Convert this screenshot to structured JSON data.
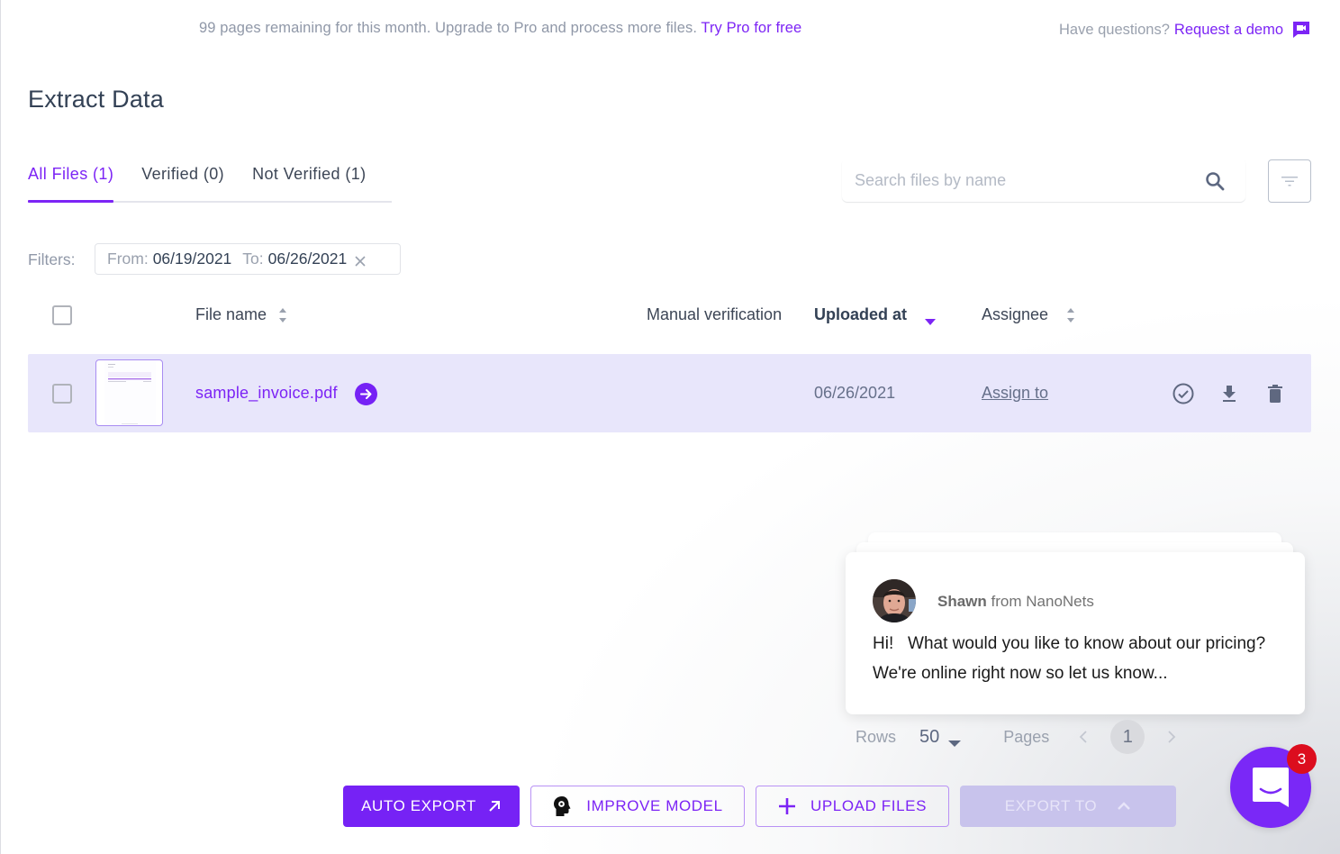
{
  "banner": {
    "quota_text": "99 pages remaining for this month. Upgrade to Pro and process more files.",
    "try_pro_link": "Try Pro for free",
    "help_text": "Have questions?",
    "demo_link": "Request a demo",
    "demo_icon": "video-chat-icon"
  },
  "page": {
    "title": "Extract Data"
  },
  "tabs": [
    {
      "label": "All Files (1)",
      "active": true
    },
    {
      "label": "Verified (0)",
      "active": false
    },
    {
      "label": "Not Verified (1)",
      "active": false
    }
  ],
  "search": {
    "placeholder": "Search files by name",
    "value": "",
    "icon": "search-icon"
  },
  "filter_button": {
    "icon": "filter-icon"
  },
  "filters": {
    "label": "Filters:",
    "from_label": "From:",
    "from_value": "06/19/2021",
    "to_label": "To:",
    "to_value": "06/26/2021"
  },
  "table": {
    "columns": {
      "file_name": "File name",
      "manual_verification": "Manual verification",
      "uploaded_at": "Uploaded at",
      "assignee": "Assignee"
    },
    "rows": [
      {
        "file_name": "sample_invoice.pdf",
        "manual_verification": "",
        "uploaded_at": "06/26/2021",
        "assignee": "Assign to",
        "actions": [
          "verify-icon",
          "download-icon",
          "delete-icon"
        ]
      }
    ]
  },
  "chat": {
    "sender_name": "Shawn",
    "sender_from": "from NanoNets",
    "message": "Hi!   What would you like to know about our pricing? We're online right now so let us know...",
    "unread_count": "3"
  },
  "pagination": {
    "rows_label": "Rows",
    "rows_value": "50",
    "pages_label": "Pages",
    "current_page": "1"
  },
  "actions": {
    "auto_export": "AUTO EXPORT",
    "improve_model": "IMPROVE MODEL",
    "upload_files": "UPLOAD FILES",
    "export_to": "EXPORT TO"
  },
  "colors": {
    "accent": "#7622f5",
    "row_highlight": "#e8e6fb",
    "badge": "#dc0d1e",
    "disabled_button": "#c8c3ec"
  }
}
